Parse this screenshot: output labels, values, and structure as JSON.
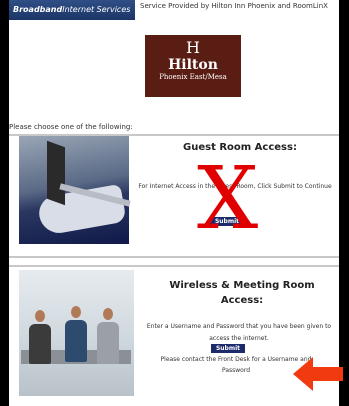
{
  "header": {
    "brand_strong": "Broadband",
    "brand_rest": "Internet Services",
    "service_text": "Service Provided by Hilton Inn Phoenix and RoomLinX"
  },
  "logo": {
    "mark": "H",
    "name": "Hilton",
    "subtitle": "Phoenix East/Mesa"
  },
  "prompt": "Please choose one of the following:",
  "guest_room": {
    "title": "Guest Room Access:",
    "description": "For Internet Access in the Guest Room, Click Submit to Continue",
    "submit_label": "Submit"
  },
  "wireless": {
    "title": "Wireless & Meeting Room Access:",
    "description": "Enter a Username and Password that you have been given to access the internet.",
    "submit_label": "Submit",
    "note": "Please contact the Front Desk for a Username and Password"
  },
  "overlay": {
    "x_mark": "X",
    "x_color": "#e10000",
    "arrow_color": "#f23a10"
  }
}
